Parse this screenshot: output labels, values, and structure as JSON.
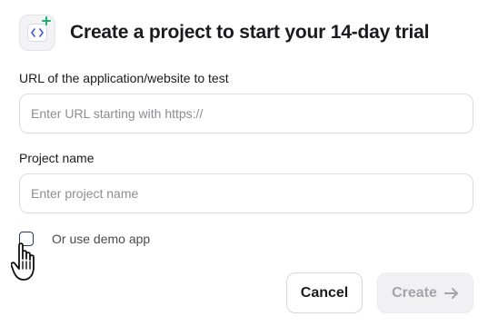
{
  "header": {
    "logo_icon": "code-brackets-plus-icon",
    "title": "Create a project to start your 14-day trial"
  },
  "form": {
    "url_label": "URL of the application/website to test",
    "url_placeholder": "Enter URL starting with https://",
    "url_value": "",
    "project_label": "Project name",
    "project_placeholder": "Enter project name",
    "project_value": "",
    "demo_checkbox_label": "Or use demo app",
    "demo_checked": false
  },
  "actions": {
    "cancel_label": "Cancel",
    "create_label": "Create",
    "create_icon": "arrow-right-icon"
  },
  "colors": {
    "accent_green": "#1fae6b",
    "icon_blue": "#3b5bdb",
    "disabled_text": "#a4a4aa"
  }
}
